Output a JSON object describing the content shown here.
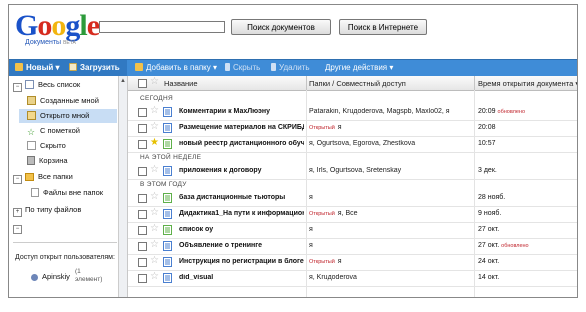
{
  "header": {
    "logo_text": "Google",
    "logo_subtitle": "Документы",
    "logo_beta": "BETA",
    "search_placeholder": "",
    "search_docs_button": "Поиск документов",
    "search_web_button": "Поиск в Интернете"
  },
  "toolbar": {
    "new_label": "Новый ▾",
    "upload_label": "Загрузить",
    "add_to_folder_label": "Добавить в папку ▾",
    "hide_label": "Скрыть",
    "delete_label": "Удалить",
    "other_actions_label": "Другие действия ▾"
  },
  "sidebar": {
    "all_items": "Весь список",
    "created_by_me": "Созданные мной",
    "opened_by_me": "Открыто мной",
    "starred": "С пометкой",
    "hidden": "Скрыто",
    "trash": "Корзина",
    "all_folders": "Все папки",
    "files_outside_folders": "Файлы вне папок",
    "by_file_type": "По типу файлов",
    "access_label": "Доступ открыт пользователям:",
    "user_name": "Apinskiy",
    "user_count": "(1",
    "user_count_unit": "элемент)"
  },
  "columns": {
    "name": "Название",
    "folders_sharing": "Папки / Совместный доступ",
    "open_time": "Время открытия документа ▾"
  },
  "groups": {
    "today": "СЕГОДНЯ",
    "this_week": "НА ЭТОЙ НЕДЕЛЕ",
    "this_year": "В ЭТОМ ГОДУ"
  },
  "rows": [
    {
      "name": "Комментарии к МахЛюэну",
      "open": "",
      "sharing": "Patarakin, Kruдoderova, Magspb, Maxlo02, я",
      "time": "20:09",
      "by": "обновлено",
      "starred": false,
      "type": "doc"
    },
    {
      "name": "Размещение материалов на СКРИБД",
      "open": "Открытый",
      "sharing": "я",
      "time": "20:08",
      "by": "",
      "starred": false,
      "type": "doc"
    },
    {
      "name": "новый реестр дистанционного обучения",
      "open": "",
      "sharing": "я, Ogurtsova, Egorova, Zhestkova",
      "time": "10:57",
      "by": "",
      "starred": true,
      "type": "sheet"
    },
    {
      "name": "приложения к договору",
      "open": "",
      "sharing": "я, Irls, Ogurtsova, Sretenskay",
      "time": "3 дек.",
      "by": "",
      "starred": false,
      "type": "doc"
    },
    {
      "name": "база дистанционные тьюторы",
      "open": "",
      "sharing": "я",
      "time": "28 нояб.",
      "by": "",
      "starred": false,
      "type": "sheet"
    },
    {
      "name": "Дидактика1_На пути к информационному",
      "open": "Открытый",
      "sharing": "я, Все",
      "time": "9 нояб.",
      "by": "",
      "starred": false,
      "type": "doc"
    },
    {
      "name": "список оу",
      "open": "",
      "sharing": "я",
      "time": "27 окт.",
      "by": "",
      "starred": false,
      "type": "sheet"
    },
    {
      "name": "Объявление о тренинге",
      "open": "",
      "sharing": "я",
      "time": "27 окт.",
      "by": "обновлено",
      "starred": false,
      "type": "doc"
    },
    {
      "name": "Инструкция по регистрации в блоге",
      "open": "Открытый",
      "sharing": "я",
      "time": "24 окт.",
      "by": "",
      "starred": false,
      "type": "doc"
    },
    {
      "name": "did_visual",
      "open": "",
      "sharing": "я, Kruдoderova",
      "time": "14 окт.",
      "by": "",
      "starred": false,
      "type": "doc"
    }
  ]
}
